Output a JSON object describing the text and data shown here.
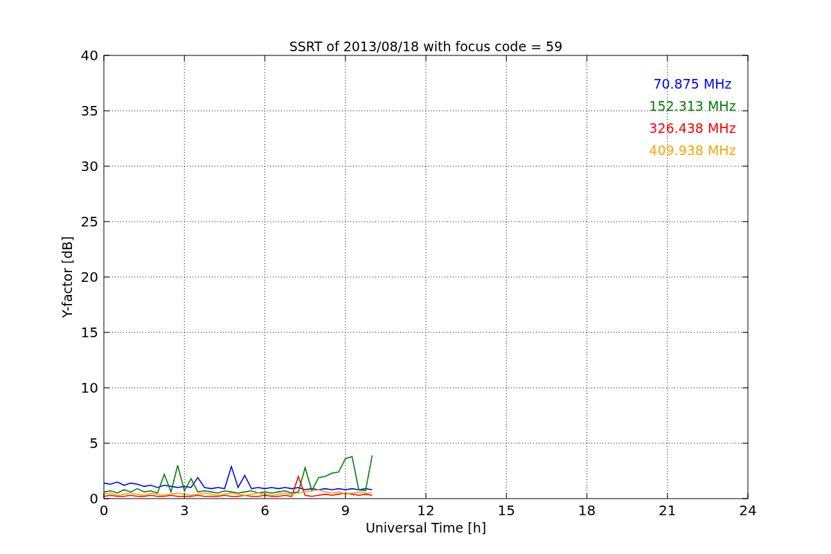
{
  "chart_data": {
    "type": "line",
    "title": "SSRT of 2013/08/18 with focus code = 59",
    "xlabel": "Universal Time [h]",
    "ylabel": "Y-factor [dB]",
    "x": [
      0,
      0.25,
      0.5,
      0.75,
      1,
      1.25,
      1.5,
      1.75,
      2,
      2.25,
      2.5,
      2.75,
      3,
      3.25,
      3.5,
      3.75,
      4,
      4.25,
      4.5,
      4.75,
      5,
      5.25,
      5.5,
      5.75,
      6,
      6.25,
      6.5,
      6.75,
      7,
      7.25,
      7.5,
      7.75,
      8,
      8.25,
      8.5,
      8.75,
      9,
      9.25,
      9.5,
      9.75,
      10
    ],
    "grid": true,
    "xlim": [
      0,
      24
    ],
    "ylim": [
      0,
      40
    ],
    "xticks": [
      0,
      3,
      6,
      9,
      12,
      15,
      18,
      21,
      24
    ],
    "yticks": [
      0,
      5,
      10,
      15,
      20,
      25,
      30,
      35,
      40
    ],
    "series": [
      {
        "name": "70.875 MHz",
        "color": "#0000ff",
        "values": [
          1.4,
          1.3,
          1.5,
          1.2,
          1.4,
          1.3,
          1.1,
          1.2,
          1.0,
          1.2,
          1.1,
          1.0,
          1.1,
          1.0,
          1.9,
          1.0,
          0.9,
          1.0,
          0.9,
          2.9,
          1.0,
          2.1,
          0.9,
          1.0,
          0.9,
          1.0,
          0.9,
          1.0,
          0.9,
          1.0,
          0.8,
          0.9,
          0.8,
          0.9,
          0.8,
          0.9,
          0.8,
          0.9,
          0.8,
          0.9,
          0.8
        ]
      },
      {
        "name": "152.313 MHz",
        "color": "#008000",
        "values": [
          0.6,
          0.7,
          0.5,
          0.8,
          0.6,
          0.9,
          0.6,
          0.7,
          0.5,
          2.2,
          0.6,
          3.0,
          0.7,
          1.8,
          0.6,
          0.7,
          0.6,
          0.5,
          0.7,
          0.6,
          0.5,
          0.6,
          0.7,
          0.5,
          0.6,
          0.5,
          0.6,
          0.7,
          0.5,
          0.6,
          2.8,
          0.7,
          1.9,
          2.0,
          2.3,
          2.4,
          3.6,
          3.8,
          0.8,
          0.7,
          3.9
        ]
      },
      {
        "name": "326.438 MHz",
        "color": "#ff0000",
        "values": [
          0.2,
          0.3,
          0.2,
          0.2,
          0.3,
          0.2,
          0.2,
          0.3,
          0.2,
          0.2,
          0.3,
          0.2,
          0.2,
          0.2,
          0.3,
          0.2,
          0.2,
          0.2,
          0.3,
          0.2,
          0.2,
          0.3,
          0.2,
          0.2,
          0.3,
          0.2,
          0.2,
          0.3,
          0.2,
          2.0,
          0.3,
          0.2,
          0.3,
          0.4,
          0.3,
          0.4,
          0.5,
          0.4,
          0.3,
          0.4,
          0.3
        ]
      },
      {
        "name": "409.938 MHz",
        "color": "#ffa500",
        "values": [
          0.4,
          0.5,
          0.3,
          0.4,
          0.5,
          0.4,
          0.3,
          0.5,
          0.4,
          0.3,
          0.4,
          0.5,
          0.4,
          0.3,
          0.4,
          0.5,
          0.4,
          0.3,
          0.4,
          0.5,
          0.4,
          0.3,
          0.4,
          0.5,
          0.4,
          0.3,
          0.4,
          0.5,
          0.4,
          0.5,
          0.6,
          0.7,
          0.8,
          0.6,
          0.5,
          0.6,
          0.4,
          0.5,
          0.6,
          0.5,
          0.5
        ]
      }
    ]
  }
}
